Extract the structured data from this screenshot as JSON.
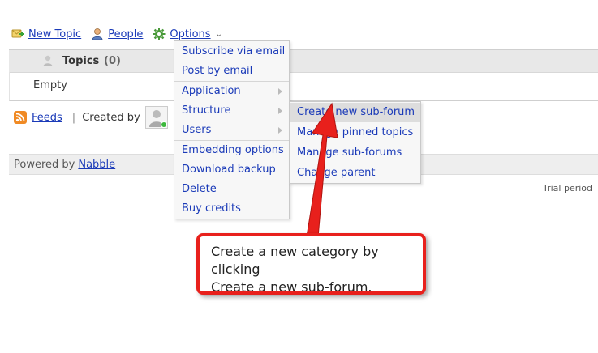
{
  "toolbar": {
    "new_topic": "New Topic",
    "people": "People",
    "options": "Options"
  },
  "topics": {
    "header_label": "Topics",
    "count": "(0)",
    "empty_text": "Empty"
  },
  "footer_row": {
    "feeds": "Feeds",
    "created_by": "Created by"
  },
  "powered": {
    "prefix": "Powered by",
    "link": "Nabble"
  },
  "trial": "Trial period",
  "options_menu": {
    "items": [
      "Subscribe via email",
      "Post by email",
      "Application",
      "Structure",
      "Users",
      "Embedding options",
      "Download backup",
      "Delete",
      "Buy credits"
    ]
  },
  "structure_menu": {
    "items": [
      "Create new sub-forum",
      "Manage pinned topics",
      "Manage sub-forums",
      "Change parent"
    ]
  },
  "callout": {
    "line1": "Create a new category by clicking",
    "line2": "Create a new sub-forum."
  },
  "colors": {
    "link": "#1a3ab8",
    "callout_border": "#e8201c",
    "arrow": "#e8201c"
  }
}
